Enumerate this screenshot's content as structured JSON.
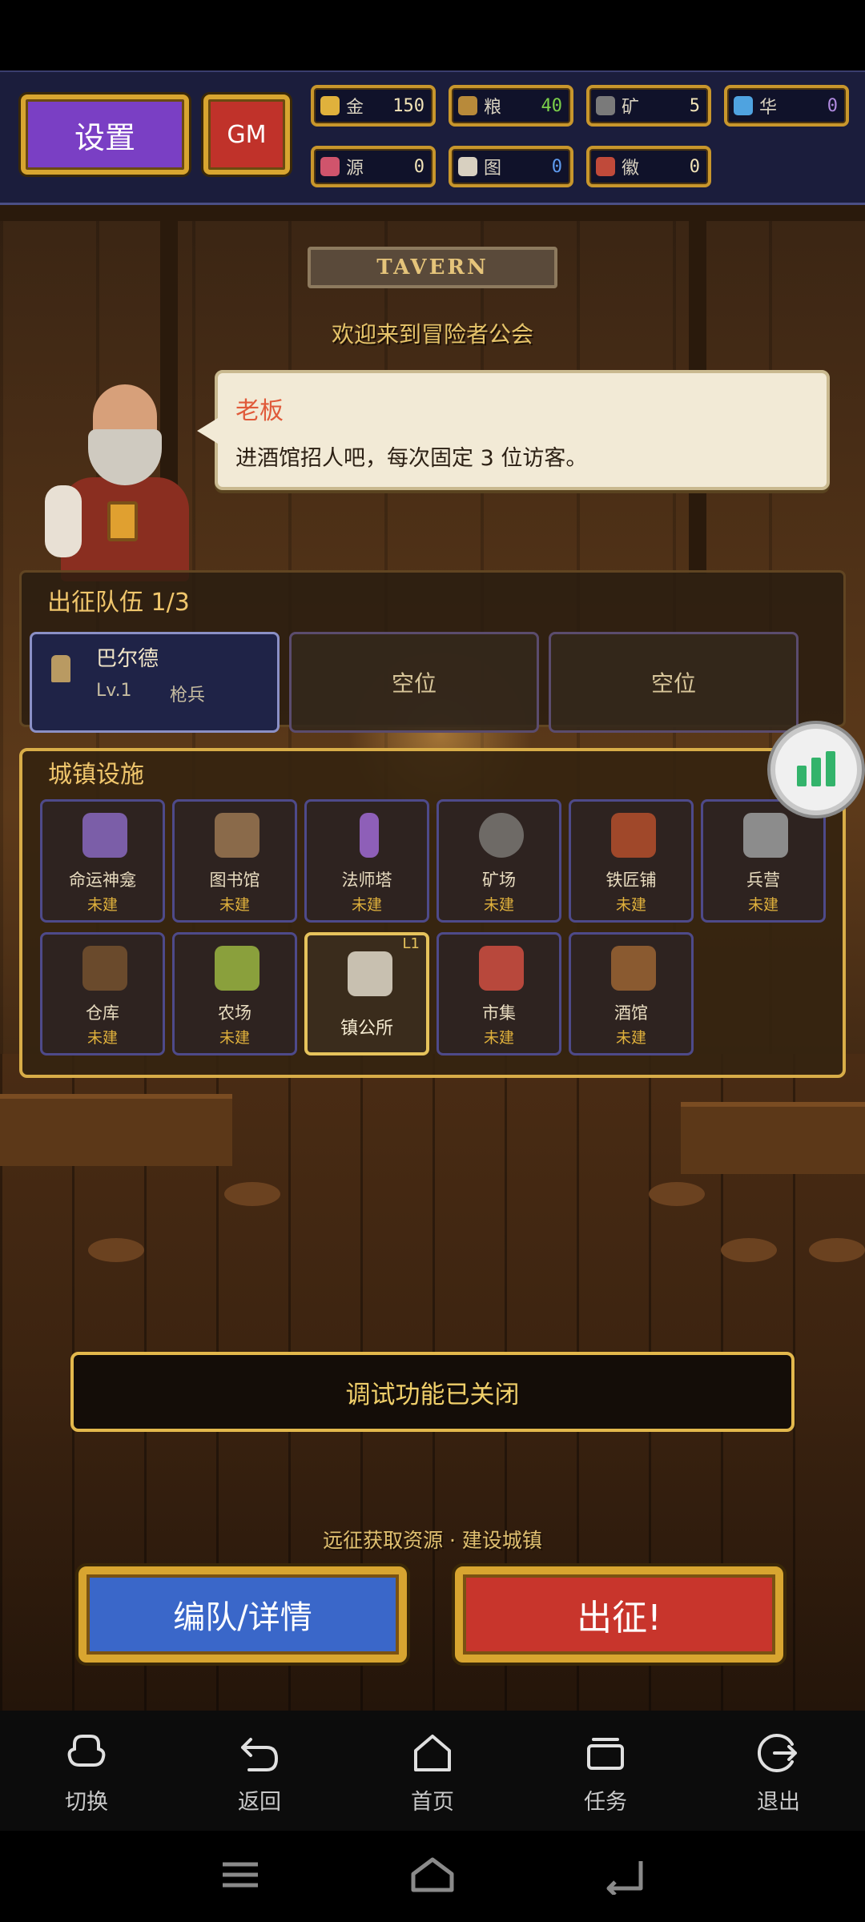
{
  "top_bar": {
    "settings_label": "设置",
    "gm_label": "GM",
    "resources": [
      {
        "icon": "gold-coin-icon",
        "label": "金",
        "value": "150",
        "color": "#e0b13c",
        "value_color": "#f2e4b8"
      },
      {
        "icon": "grain-icon",
        "label": "粮",
        "value": "40",
        "color": "#b88a3a",
        "value_color": "#7cd04a"
      },
      {
        "icon": "ore-icon",
        "label": "矿",
        "value": "5",
        "color": "#7a7a7a",
        "value_color": "#f2e4b8"
      },
      {
        "icon": "crystal-icon",
        "label": "华",
        "value": "0",
        "color": "#4fa3e0",
        "value_color": "#b08ae0"
      },
      {
        "icon": "source-icon",
        "label": "源",
        "value": "0",
        "color": "#d0546c",
        "value_color": "#f2e4b8"
      },
      {
        "icon": "map-icon",
        "label": "图",
        "value": "0",
        "color": "#d8d0c0",
        "value_color": "#5f9cf0"
      },
      {
        "icon": "emblem-icon",
        "label": "徽",
        "value": "0",
        "color": "#c04a3a",
        "value_color": "#f2e4b8"
      }
    ]
  },
  "scene": {
    "sign": "TAVERN",
    "welcome": "欢迎来到冒险者公会"
  },
  "dialogue": {
    "speaker": "老板",
    "text": "进酒馆招人吧，每次固定 3 位访客。"
  },
  "party": {
    "title": "出征队伍 1/3",
    "members": [
      {
        "name": "巴尔德",
        "level": "Lv.1",
        "class": "枪兵"
      }
    ],
    "empty_label": "空位"
  },
  "facilities": {
    "title": "城镇设施",
    "items": [
      {
        "name": "命运神龛",
        "status": "未建",
        "color": "#7b5ea8"
      },
      {
        "name": "图书馆",
        "status": "未建",
        "color": "#8a6a4a"
      },
      {
        "name": "法师塔",
        "status": "未建",
        "color": "#8e5fb8"
      },
      {
        "name": "矿场",
        "status": "未建",
        "color": "#6e6a66"
      },
      {
        "name": "铁匠铺",
        "status": "未建",
        "color": "#a0482a"
      },
      {
        "name": "兵营",
        "status": "未建",
        "color": "#8c8c8c"
      },
      {
        "name": "仓库",
        "status": "未建",
        "color": "#6a4a2c"
      },
      {
        "name": "农场",
        "status": "未建",
        "color": "#8aa03c"
      },
      {
        "name": "镇公所",
        "status": "",
        "level": "L1",
        "color": "#c8c0b0"
      },
      {
        "name": "市集",
        "status": "未建",
        "color": "#b8483c"
      },
      {
        "name": "酒馆",
        "status": "未建",
        "color": "#8a5a30"
      }
    ]
  },
  "debug_label": "调试功能已关闭",
  "tagline": "远征获取资源 · 建设城镇",
  "actions": {
    "formation_label": "编队/详情",
    "sortie_label": "出征!"
  },
  "nav": [
    {
      "icon": "switch-icon",
      "label": "切换"
    },
    {
      "icon": "back-icon",
      "label": "返回"
    },
    {
      "icon": "home-icon",
      "label": "首页"
    },
    {
      "icon": "tasks-icon",
      "label": "任务"
    },
    {
      "icon": "exit-icon",
      "label": "退出"
    }
  ]
}
